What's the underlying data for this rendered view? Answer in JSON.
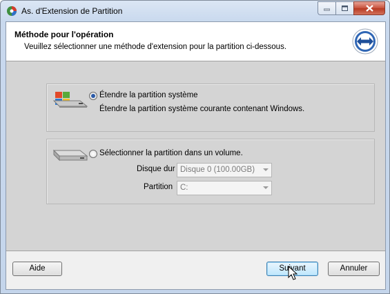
{
  "window": {
    "title": "As. d'Extension de Partition"
  },
  "header": {
    "title": "Méthode pour l'opération",
    "subtitle": "Veuillez sélectionner une méthode d'extension pour la partition ci-dessous."
  },
  "options": {
    "system": {
      "label": "Étendre la partition système",
      "description": "Étendre la partition système courante contenant Windows.",
      "selected": true
    },
    "volume": {
      "label": "Sélectionner la partition dans un volume.",
      "selected": false,
      "disk_label": "Disque dur",
      "disk_value": "Disque 0 (100.00GB)",
      "partition_label": "Partition",
      "partition_value": "C:"
    }
  },
  "footer": {
    "help_label": "Aide",
    "next_label": "Suivant",
    "cancel_label": "Annuler"
  },
  "colors": {
    "accent": "#2a5aa8",
    "close_button": "#c7503a"
  }
}
